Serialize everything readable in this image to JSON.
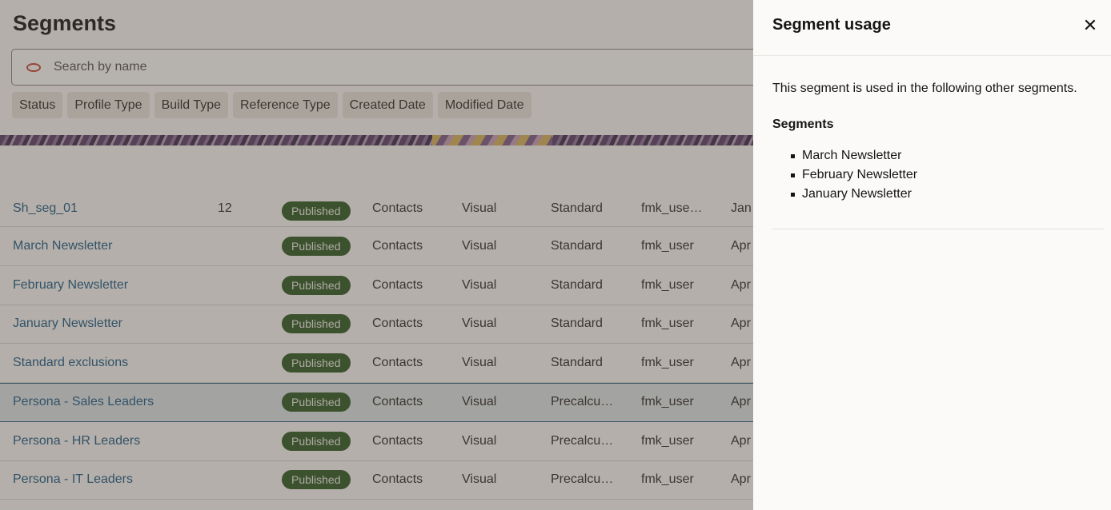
{
  "page": {
    "title": "Segments"
  },
  "search": {
    "placeholder": "Search by name"
  },
  "filters": [
    "Status",
    "Profile Type",
    "Build Type",
    "Reference Type",
    "Created Date",
    "Modified Date"
  ],
  "table": {
    "rows": [
      {
        "name": "Sh_seg_01",
        "count": "12",
        "status": "Published",
        "profile_type": "Contacts",
        "build_type": "Visual",
        "reference_type": "Standard",
        "user": "fmk_use…",
        "date": "Jan",
        "selected": false
      },
      {
        "name": "March Newsletter",
        "count": "",
        "status": "Published",
        "profile_type": "Contacts",
        "build_type": "Visual",
        "reference_type": "Standard",
        "user": "fmk_user",
        "date": "Apr",
        "selected": false
      },
      {
        "name": "February Newsletter",
        "count": "",
        "status": "Published",
        "profile_type": "Contacts",
        "build_type": "Visual",
        "reference_type": "Standard",
        "user": "fmk_user",
        "date": "Apr",
        "selected": false
      },
      {
        "name": "January Newsletter",
        "count": "",
        "status": "Published",
        "profile_type": "Contacts",
        "build_type": "Visual",
        "reference_type": "Standard",
        "user": "fmk_user",
        "date": "Apr",
        "selected": false
      },
      {
        "name": "Standard exclusions",
        "count": "",
        "status": "Published",
        "profile_type": "Contacts",
        "build_type": "Visual",
        "reference_type": "Standard",
        "user": "fmk_user",
        "date": "Apr",
        "selected": false
      },
      {
        "name": "Persona - Sales Leaders",
        "count": "",
        "status": "Published",
        "profile_type": "Contacts",
        "build_type": "Visual",
        "reference_type": "Precalcu…",
        "user": "fmk_user",
        "date": "Apr",
        "selected": true
      },
      {
        "name": "Persona - HR Leaders",
        "count": "",
        "status": "Published",
        "profile_type": "Contacts",
        "build_type": "Visual",
        "reference_type": "Precalcu…",
        "user": "fmk_user",
        "date": "Apr",
        "selected": false
      },
      {
        "name": "Persona - IT Leaders",
        "count": "",
        "status": "Published",
        "profile_type": "Contacts",
        "build_type": "Visual",
        "reference_type": "Precalcu…",
        "user": "fmk_user",
        "date": "Apr",
        "selected": false
      }
    ]
  },
  "panel": {
    "title": "Segment usage",
    "close_icon": "close-icon",
    "description": "This segment is used in the following other segments.",
    "subheading": "Segments",
    "items": [
      "March Newsletter",
      "February Newsletter",
      "January Newsletter"
    ]
  },
  "colors": {
    "brand": "#c74634",
    "link": "#1c5a86",
    "badge": "#2e5b23",
    "selected_row": "#dfe7ea"
  }
}
